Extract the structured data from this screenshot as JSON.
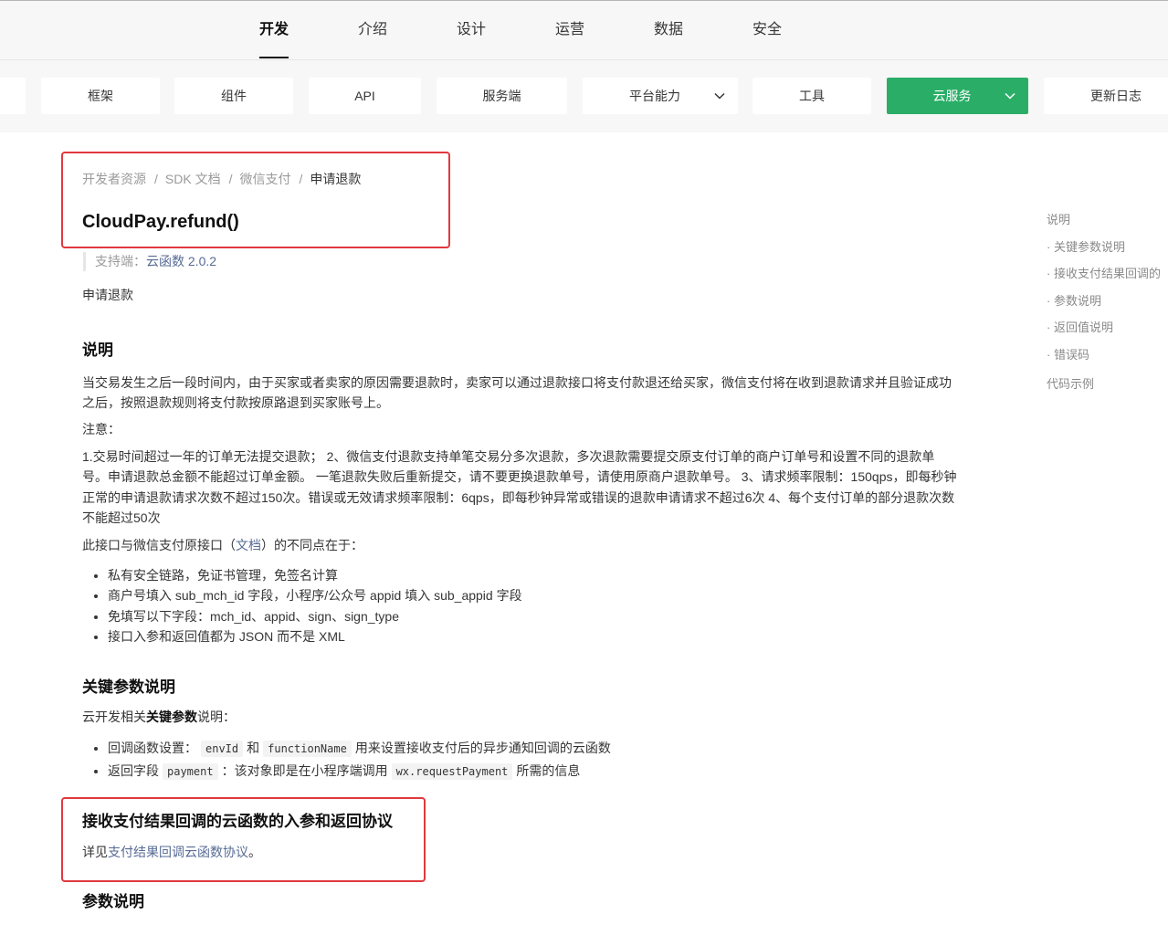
{
  "colors": {
    "accent_green": "#2aae67",
    "link": "#576b95",
    "highlight_red": "#e0393e"
  },
  "top_nav": {
    "tabs": [
      {
        "label": "开发",
        "active": true
      },
      {
        "label": "介绍"
      },
      {
        "label": "设计"
      },
      {
        "label": "运营"
      },
      {
        "label": "数据"
      },
      {
        "label": "安全"
      }
    ]
  },
  "sub_nav": {
    "items": [
      {
        "label": "框架"
      },
      {
        "label": "组件"
      },
      {
        "label": "API"
      },
      {
        "label": "服务端"
      },
      {
        "label": "平台能力",
        "icon": "chevron-down-icon"
      },
      {
        "label": "工具"
      },
      {
        "label": "云服务",
        "active": true,
        "icon": "chevron-down-icon"
      },
      {
        "label": "更新日志"
      }
    ]
  },
  "breadcrumb": {
    "separator": "/",
    "items": [
      "开发者资源",
      "SDK 文档",
      "微信支付",
      "申请退款"
    ]
  },
  "page": {
    "title": "CloudPay.refund()",
    "support_label": "支持端：",
    "support_value": "云函数 2.0.2",
    "intro": "申请退款"
  },
  "description": {
    "heading": "说明",
    "paragraph": "当交易发生之后一段时间内，由于买家或者卖家的原因需要退款时，卖家可以通过退款接口将支付款退还给买家，微信支付将在收到退款请求并且验证成功之后，按照退款规则将支付款按原路退到买家账号上。",
    "note_label": "注意：",
    "note_text": "1.交易时间超过一年的订单无法提交退款； 2、微信支付退款支持单笔交易分多次退款，多次退款需要提交原支付订单的商户订单号和设置不同的退款单号。申请退款总金额不能超过订单金额。 一笔退款失败后重新提交，请不要更换退款单号，请使用原商户退款单号。 3、请求频率限制：150qps，即每秒钟正常的申请退款请求次数不超过150次。错误或无效请求频率限制：6qps，即每秒钟异常或错误的退款申请请求不超过6次 4、每个支付订单的部分退款次数不能超过50次",
    "diff_prefix": "此接口与微信支付原接口（",
    "diff_link": "文档",
    "diff_suffix": "）的不同点在于：",
    "differences": [
      "私有安全链路，免证书管理，免签名计算",
      "商户号填入 sub_mch_id 字段，小程序/公众号 appid 填入 sub_appid 字段",
      "免填写以下字段：mch_id、appid、sign、sign_type",
      "接口入参和返回值都为 JSON 而不是 XML"
    ]
  },
  "key_params": {
    "heading": "关键参数说明",
    "intro_prefix": "云开发相关",
    "intro_bold": "关键参数",
    "intro_suffix": "说明：",
    "items": [
      {
        "text_1": "回调函数设置：",
        "code_1": "envId",
        "text_2": "和",
        "code_2": "functionName",
        "text_3": "用来设置接收支付后的异步通知回调的云函数"
      },
      {
        "text_1": "返回字段",
        "code_1": "payment",
        "text_2": "：该对象即是在小程序端调用",
        "code_2": "wx.requestPayment",
        "text_3": "所需的信息"
      }
    ]
  },
  "callback_protocol": {
    "heading": "接收支付结果回调的云函数的入参和返回协议",
    "text_prefix": "详见",
    "link": "支付结果回调云函数协议",
    "text_suffix": "。"
  },
  "params": {
    "heading": "参数说明"
  },
  "toc": {
    "items": [
      {
        "label": "说明",
        "level": 1
      },
      {
        "label": "关键参数说明",
        "level": 2
      },
      {
        "label": "接收支付结果回调的",
        "level": 2
      },
      {
        "label": "参数说明",
        "level": 2
      },
      {
        "label": "返回值说明",
        "level": 2
      },
      {
        "label": "错误码",
        "level": 2
      },
      {
        "label": "代码示例",
        "level": 1
      }
    ]
  }
}
